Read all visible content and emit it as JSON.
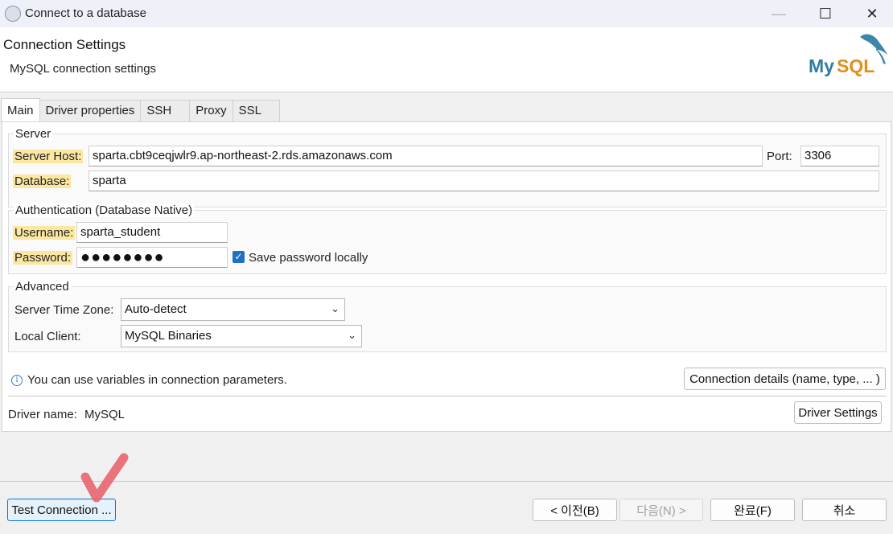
{
  "window": {
    "title": "Connect to a database",
    "min_icon": "minimize-icon",
    "max_icon": "maximize-icon",
    "close_icon": "close-icon"
  },
  "header": {
    "title": "Connection Settings",
    "subtitle": "MySQL connection settings",
    "logo_text": "MySQL"
  },
  "tabs": [
    {
      "label": "Main",
      "active": true
    },
    {
      "label": "Driver properties",
      "active": false
    },
    {
      "label": "SSH",
      "active": false
    },
    {
      "label": "Proxy",
      "active": false
    },
    {
      "label": "SSL",
      "active": false
    }
  ],
  "server": {
    "group_label": "Server",
    "host_label": "Server Host:",
    "host_value": "sparta.cbt9ceqjwlr9.ap-northeast-2.rds.amazonaws.com",
    "port_label": "Port:",
    "port_value": "3306",
    "database_label": "Database:",
    "database_value": "sparta"
  },
  "auth": {
    "group_label": "Authentication (Database Native)",
    "username_label": "Username:",
    "username_value": "sparta_student",
    "password_label": "Password:",
    "password_value": "●●●●●●●●",
    "save_password_label": "Save password locally",
    "save_password_checked": true
  },
  "advanced": {
    "group_label": "Advanced",
    "timezone_label": "Server Time Zone:",
    "timezone_value": "Auto-detect",
    "client_label": "Local Client:",
    "client_value": "MySQL Binaries"
  },
  "info": {
    "text": "You can use variables in connection parameters.",
    "details_button": "Connection details (name, type, ... )"
  },
  "driver": {
    "name_label": "Driver name:",
    "name_value": "MySQL",
    "settings_button": "Driver Settings"
  },
  "footer": {
    "test_button": "Test Connection ...",
    "back_button": "< 이전(B)",
    "next_button": "다음(N) >",
    "finish_button": "완료(F)",
    "cancel_button": "취소"
  },
  "colors": {
    "highlight": "#fbe7a0",
    "accent": "#1f6fc5",
    "annotation_check": "#e8646e"
  }
}
